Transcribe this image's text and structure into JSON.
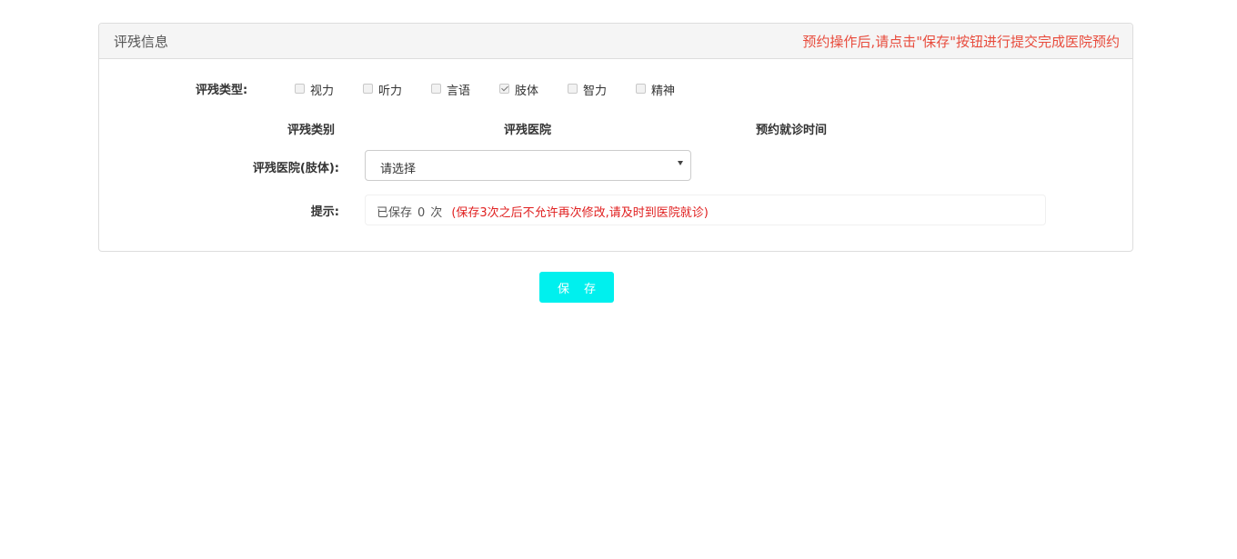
{
  "panel": {
    "title": "评残信息",
    "notice": "预约操作后,请点击\"保存\"按钮进行提交完成医院预约"
  },
  "types": {
    "label": "评残类型:",
    "options": [
      {
        "label": "视力",
        "checked": false
      },
      {
        "label": "听力",
        "checked": false
      },
      {
        "label": "言语",
        "checked": false
      },
      {
        "label": "肢体",
        "checked": true
      },
      {
        "label": "智力",
        "checked": false
      },
      {
        "label": "精神",
        "checked": false
      }
    ]
  },
  "columns": {
    "category": "评残类别",
    "hospital": "评残医院",
    "time": "预约就诊时间"
  },
  "hospital_select": {
    "label": "评残医院(肢体):",
    "value": "请选择"
  },
  "hint": {
    "label": "提示:",
    "prefix": "已保存",
    "count": "0",
    "suffix": "次",
    "warning": "(保存3次之后不允许再次修改,请及时到医院就诊)"
  },
  "save_button": {
    "label": "保存"
  }
}
